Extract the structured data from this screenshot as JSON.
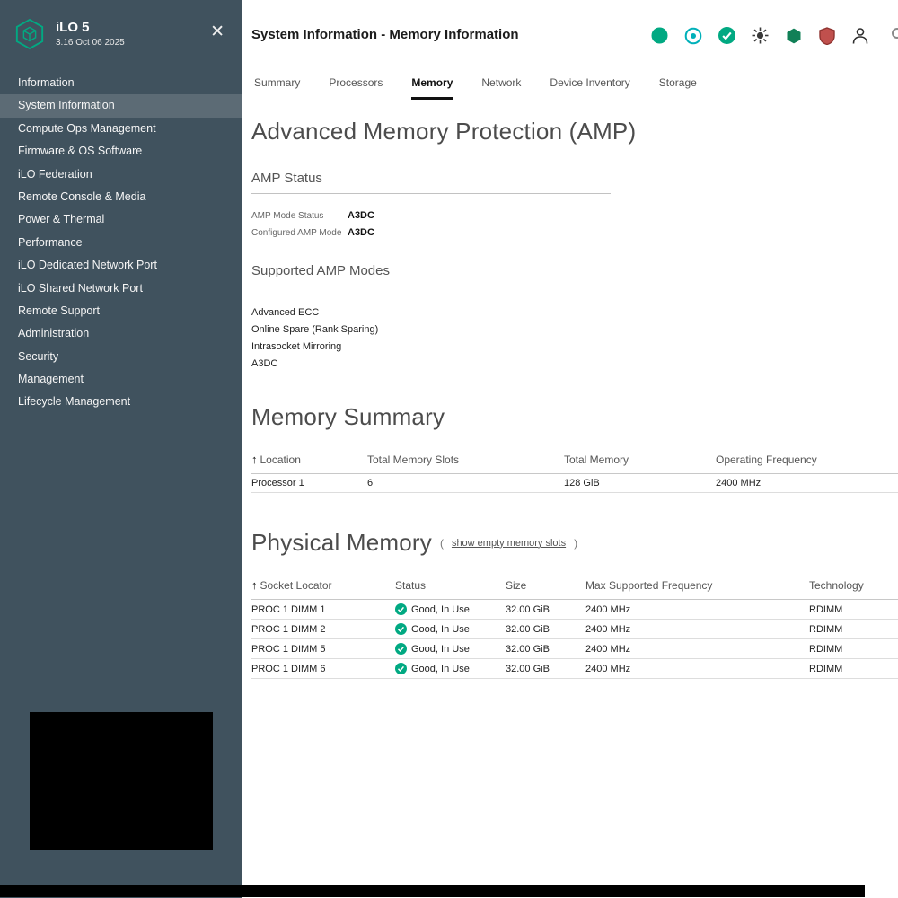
{
  "sidebar": {
    "app_title": "iLO 5",
    "app_version": "3.16 Oct 06 2025",
    "close_glyph": "✕",
    "items": [
      {
        "label": "Information"
      },
      {
        "label": "System Information"
      },
      {
        "label": "Compute Ops Management"
      },
      {
        "label": "Firmware & OS Software"
      },
      {
        "label": "iLO Federation"
      },
      {
        "label": "Remote Console & Media"
      },
      {
        "label": "Power & Thermal"
      },
      {
        "label": "Performance"
      },
      {
        "label": "iLO Dedicated Network Port"
      },
      {
        "label": "iLO Shared Network Port"
      },
      {
        "label": "Remote Support"
      },
      {
        "label": "Administration"
      },
      {
        "label": "Security"
      },
      {
        "label": "Management"
      },
      {
        "label": "Lifecycle Management"
      }
    ]
  },
  "header": {
    "title": "System Information - Memory Information",
    "icons": [
      {
        "name": "circle-icon",
        "color": "#01a982"
      },
      {
        "name": "target-icon",
        "color": "#00b0b9"
      },
      {
        "name": "check-circle-icon",
        "color": "#01a982"
      },
      {
        "name": "sun-icon",
        "color": "#3a3a3a"
      },
      {
        "name": "hexagon-icon",
        "color": "#118057"
      },
      {
        "name": "shield-icon",
        "color": "#c0504d"
      },
      {
        "name": "person-icon",
        "color": "#2d2d2d"
      }
    ]
  },
  "tabs": [
    {
      "label": "Summary"
    },
    {
      "label": "Processors"
    },
    {
      "label": "Memory",
      "active": true
    },
    {
      "label": "Network"
    },
    {
      "label": "Device Inventory"
    },
    {
      "label": "Storage"
    }
  ],
  "amp": {
    "heading": "Advanced Memory Protection (AMP)",
    "status_heading": "AMP Status",
    "fields": [
      {
        "label": "AMP Mode Status",
        "value": "A3DC"
      },
      {
        "label": "Configured AMP Mode",
        "value": "A3DC"
      }
    ],
    "modes_heading": "Supported AMP Modes",
    "modes": [
      "Advanced ECC",
      "Online Spare (Rank Sparing)",
      "Intrasocket Mirroring",
      "A3DC"
    ]
  },
  "memory_summary": {
    "heading": "Memory Summary",
    "sort_glyph": "↑",
    "columns": [
      "Location",
      "Total Memory Slots",
      "Total Memory",
      "Operating Frequency"
    ],
    "rows": [
      [
        "Processor 1",
        "6",
        "128 GiB",
        "2400 MHz"
      ]
    ]
  },
  "physical_memory": {
    "heading": "Physical Memory",
    "paren_open": "(",
    "paren_close": ")",
    "link": "show empty memory slots",
    "sort_glyph": "↑",
    "columns": [
      "Socket Locator",
      "Status",
      "Size",
      "Max Supported Frequency",
      "Technology"
    ],
    "rows": [
      {
        "socket": "PROC 1 DIMM 1",
        "status": "Good, In Use",
        "size": "32.00 GiB",
        "freq": "2400 MHz",
        "tech": "RDIMM"
      },
      {
        "socket": "PROC 1 DIMM 2",
        "status": "Good, In Use",
        "size": "32.00 GiB",
        "freq": "2400 MHz",
        "tech": "RDIMM"
      },
      {
        "socket": "PROC 1 DIMM 5",
        "status": "Good, In Use",
        "size": "32.00 GiB",
        "freq": "2400 MHz",
        "tech": "RDIMM"
      },
      {
        "socket": "PROC 1 DIMM 6",
        "status": "Good, In Use",
        "size": "32.00 GiB",
        "freq": "2400 MHz",
        "tech": "RDIMM"
      }
    ]
  }
}
